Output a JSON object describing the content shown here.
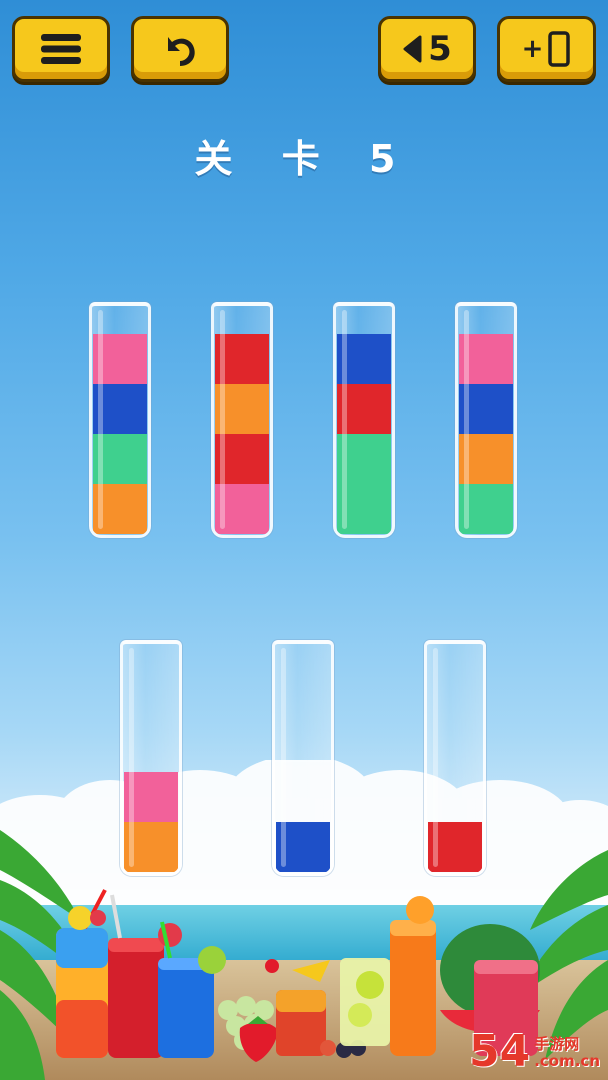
{
  "toolbar": {
    "menu_icon": "hamburger-menu-icon",
    "undo_icon": "undo-arrow-icon",
    "back_icon": "triangle-left-icon",
    "back_count": "5",
    "add_tube_label": "+",
    "add_tube_icon": "phone-tube-icon"
  },
  "level": {
    "title": "关 卡 5"
  },
  "colors": {
    "pink": "#f2619a",
    "blue": "#1e50c8",
    "green": "#3fd08e",
    "orange": "#f7902a",
    "red": "#e0262b",
    "button_yellow": "#f6c81c"
  },
  "tubes_row1": [
    {
      "segments_bottom_to_top": [
        "orange",
        "green",
        "blue",
        "pink"
      ]
    },
    {
      "segments_bottom_to_top": [
        "pink",
        "red",
        "orange",
        "red"
      ]
    },
    {
      "segments_bottom_to_top": [
        "green",
        "green",
        "red",
        "blue"
      ]
    },
    {
      "segments_bottom_to_top": [
        "green",
        "orange",
        "blue",
        "pink"
      ]
    }
  ],
  "tubes_row2": [
    {
      "segments_bottom_to_top": [
        "orange",
        "pink"
      ]
    },
    {
      "segments_bottom_to_top": [
        "blue"
      ]
    },
    {
      "segments_bottom_to_top": [
        "red"
      ]
    }
  ],
  "decoration": {
    "scene": "beach-drinks-illustration",
    "items": [
      "palm-leaf-icon",
      "layered-cocktail-icon",
      "red-juice-glass-icon",
      "blue-drink-icon",
      "grapes-icon",
      "strawberry-icon",
      "tropical-drink-icon",
      "lemonade-icon",
      "orange-juice-icon",
      "watermelon-icon",
      "berry-juice-icon"
    ]
  },
  "watermark": {
    "big": "54",
    "mid": "手游网",
    "small": ".com.cn"
  }
}
